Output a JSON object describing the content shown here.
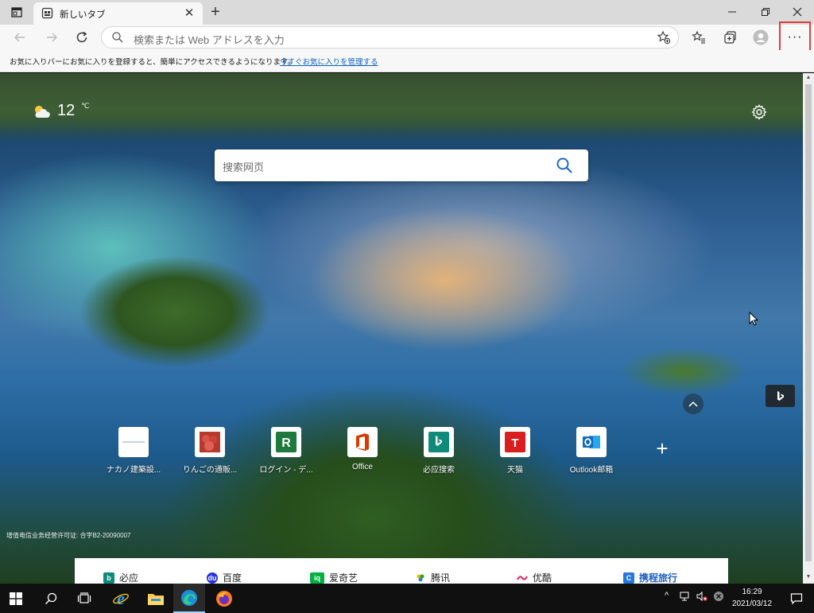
{
  "tab": {
    "title": "新しいタブ"
  },
  "toolbar": {
    "address_placeholder": "検索または Web アドレスを入力"
  },
  "favorites_bar": {
    "message": "お気に入りバーにお気に入りを登録すると、簡単にアクセスできるようになります。",
    "manage_link": "今すぐお気に入りを管理する"
  },
  "menu": {
    "label": "···"
  },
  "weather": {
    "temperature": "12",
    "unit": "℃"
  },
  "search": {
    "placeholder": "搜索网页"
  },
  "tiles": [
    {
      "label": "ナカノ建築設...",
      "icon": "nakano-logo"
    },
    {
      "label": "りんごの通販...",
      "icon": "apple-photo"
    },
    {
      "label": "ログイン - デ...",
      "icon": "r-logo",
      "glyph": "R",
      "color": "#1e7a3c"
    },
    {
      "label": "Office",
      "icon": "office-logo",
      "color": "#d83b01"
    },
    {
      "label": "必应搜索",
      "icon": "bing-logo",
      "color": "#0f8a7a"
    },
    {
      "label": "天猫",
      "icon": "tmall-logo",
      "glyph": "T",
      "color": "#d81e1e"
    },
    {
      "label": "Outlook邮箱",
      "icon": "outlook-logo",
      "color": "#0f6cbd"
    }
  ],
  "license": "增值电信业务经营许可证: 合字B2-20090007",
  "quick_links": [
    {
      "label": "必应",
      "icon": "bing-icon",
      "color": "#0f8a7a",
      "glyph": "b"
    },
    {
      "label": "百度",
      "icon": "baidu-icon",
      "color": "#2932e1",
      "glyph": "●"
    },
    {
      "label": "爱奇艺",
      "icon": "iqiyi-icon",
      "color": "#00b140",
      "glyph": "iq"
    },
    {
      "label": "腾讯",
      "icon": "tencent-icon",
      "color": "#f4b400",
      "glyph": "•"
    },
    {
      "label": "优酷",
      "icon": "youku-icon",
      "color": "#e0245e",
      "glyph": "~"
    },
    {
      "label": "携程旅行",
      "icon": "ctrip-icon",
      "color": "#2577e3",
      "glyph": "C"
    }
  ],
  "taskbar": {
    "time": "16:29",
    "date": "2021/03/12"
  }
}
